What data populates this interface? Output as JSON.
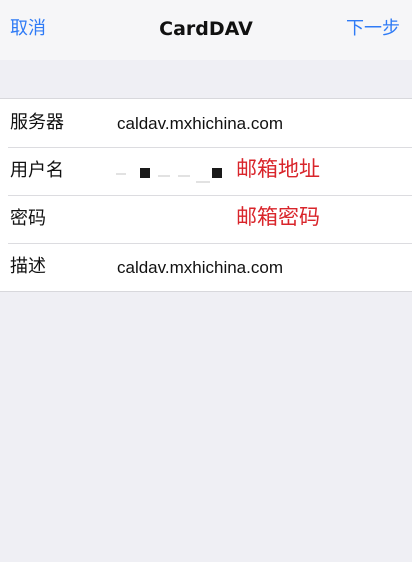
{
  "nav": {
    "cancel": "取消",
    "title": "CardDAV",
    "next": "下一步"
  },
  "form": {
    "rows": [
      {
        "label": "服务器",
        "value": "caldav.mxhichina.com"
      },
      {
        "label": "用户名",
        "value": "",
        "hint": "邮箱地址"
      },
      {
        "label": "密码",
        "value": "",
        "hint": "邮箱密码"
      },
      {
        "label": "描述",
        "value": "caldav.mxhichina.com"
      }
    ]
  },
  "colors": {
    "accent": "#2f7bf6",
    "hint": "#d9252b",
    "background": "#efeff4"
  }
}
